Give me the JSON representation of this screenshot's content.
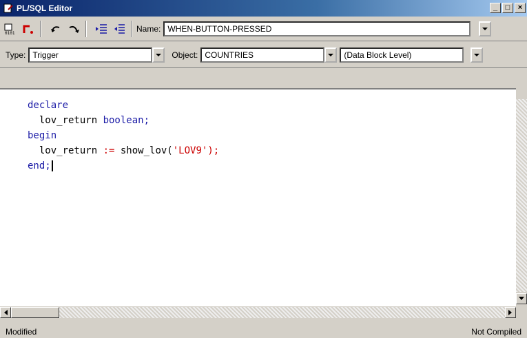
{
  "window": {
    "title": "PL/SQL Editor"
  },
  "toolbar": {
    "name_label": "Name:",
    "name_value": "WHEN-BUTTON-PRESSED"
  },
  "selectors": {
    "type_label": "Type:",
    "type_value": "Trigger",
    "object_label": "Object:",
    "object_value": "COUNTRIES",
    "level_value": "(Data Block Level)"
  },
  "code": {
    "line1_kw": "declare",
    "line2_plain": "  lov_return ",
    "line2_kw": "boolean;",
    "line3_kw": "begin",
    "line4_plain": "  lov_return ",
    "line4_op": ":=",
    "line4_fn": " show_lov(",
    "line4_str": "'LOV9'",
    "line4_end": ");",
    "line5_kw": "end;"
  },
  "status": {
    "left": "Modified",
    "right": "Not Compiled"
  },
  "colors": {
    "titlebar": "#0a246a",
    "keyword": "#1a1aa6",
    "operator": "#cc0000"
  }
}
